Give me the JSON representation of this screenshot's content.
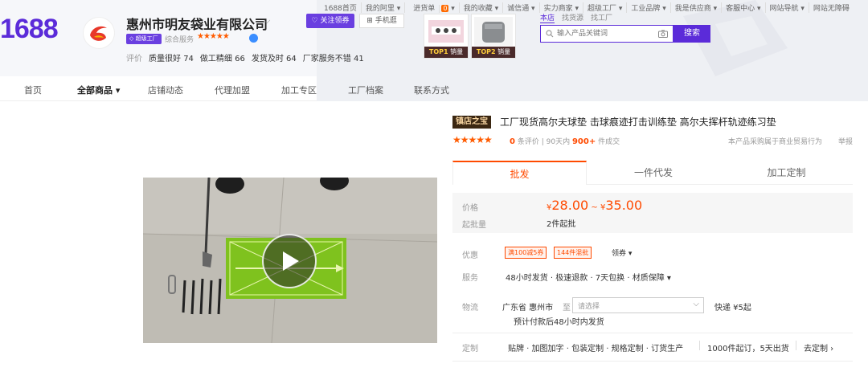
{
  "header": {
    "logo": "1688",
    "shop_name": "惠州市明友袋业有限公司",
    "shop_badge": "超级工厂",
    "rank_label": "综合服务",
    "rank_stars": "★★★★★",
    "ratings": [
      {
        "label": "质量很好",
        "value": "74"
      },
      {
        "label": "做工精细",
        "value": "66"
      },
      {
        "label": "发货及时",
        "value": "64"
      },
      {
        "label": "厂家服务不错",
        "value": "41"
      }
    ],
    "ratings_prefix": "评价",
    "follow_label": "♡ 关注领券",
    "mobile_label": "⊞ 手机逛",
    "top_nav": [
      "1688首页",
      "我的阿里 ▾",
      "进货单",
      "我的收藏 ▾",
      "诚信通 ▾",
      "实力商家 ▾",
      "超级工厂 ▾",
      "工业品牌 ▾",
      "我是供应商 ▾",
      "客服中心 ▾",
      "网站导航 ▾",
      "网站无障碍"
    ],
    "cart_count": "0",
    "top_products": [
      {
        "rank": "TOP1",
        "label": "销量"
      },
      {
        "rank": "TOP2",
        "label": "销量"
      }
    ],
    "search_tabs": [
      "本店",
      "找货源",
      "找工厂"
    ],
    "search_placeholder": "输入产品关键词",
    "search_button": "搜索"
  },
  "shop_nav": [
    "首页",
    "全部商品 ▾",
    "店铺动态",
    "代理加盟",
    "加工专区",
    "工厂档案",
    "联系方式"
  ],
  "product": {
    "shop_badge": "镇店之宝",
    "title": "工厂现货高尔夫球垫 击球痕迹打击训练垫 高尔夫挥杆轨迹练习垫",
    "stars": "★★★★★",
    "review_count": "0",
    "review_label": "条评价",
    "sold_period": "90天内",
    "sold_count": "900+",
    "sold_label": "件成交",
    "trade_note": "本产品采购属于商业贸易行为",
    "report": "举报",
    "tabs": [
      "批发",
      "一件代发",
      "加工定制"
    ],
    "price_label": "价格",
    "price_low": "28.00",
    "price_high": "35.00",
    "currency": "¥",
    "price_sep": "~",
    "moq_label": "起批量",
    "moq": "2件起批",
    "discount_label": "优惠",
    "coupons": [
      "满100减5券",
      "144件混批"
    ],
    "get_coupon": "领券 ▾",
    "service_label": "服务",
    "service_text": "48小时发货 · 极速退款 · 7天包换 · 材质保障 ▾",
    "logistics_label": "物流",
    "origin": "广东省 惠州市",
    "to_label": "至",
    "region_placeholder": "请选择",
    "shipping": "快递  ¥5起",
    "ship_note": "预计付款后48小时内发货",
    "custom_label": "定制",
    "custom_text": "贴牌 · 加图加字 · 包装定制 · 规格定制 · 订货生产",
    "custom_moq": "1000件起订，5天出货",
    "custom_link": "去定制 ›"
  }
}
